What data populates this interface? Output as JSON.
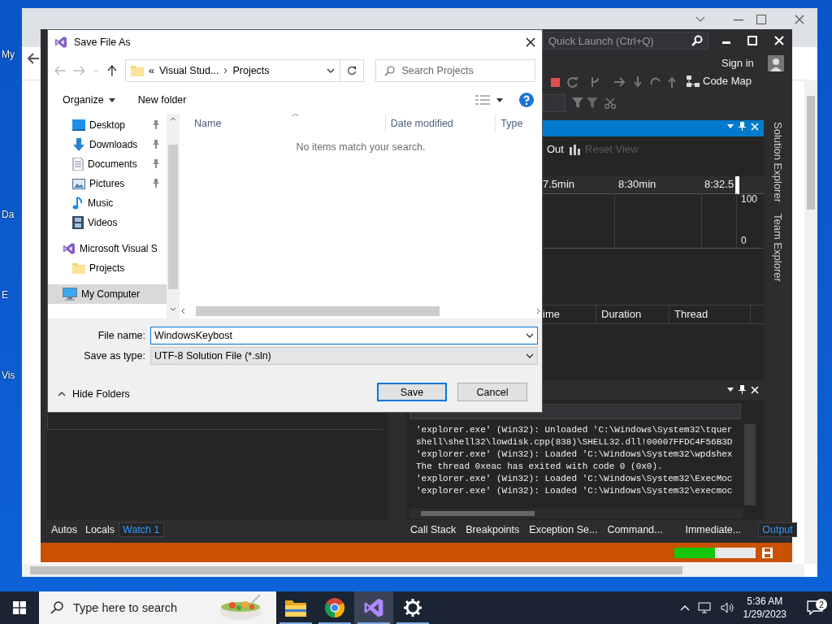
{
  "desktop": {
    "icon_labels": [
      "My",
      "Da",
      "E",
      "Vis"
    ]
  },
  "visual_studio": {
    "quick_launch": {
      "placeholder": "Quick Launch (Ctrl+Q)"
    },
    "sign_in": "Sign in",
    "code_map": "Code Map",
    "diagnostics": {
      "actions": [
        {
          "label": "Out",
          "disabled": false
        },
        {
          "label": "Reset View",
          "disabled": true
        }
      ],
      "time_ticks": [
        "7.5min",
        "8:30min",
        "8:32.5"
      ],
      "scale": [
        "100",
        "0"
      ],
      "columns": [
        "ime",
        "Duration",
        "Thread"
      ]
    },
    "side_tabs": [
      "Solution Explorer",
      "Team Explorer"
    ],
    "output_lines": [
      "'explorer.exe' (Win32): Unloaded 'C:\\Windows\\System32\\tquer",
      "shell\\shell32\\lowdisk.cpp(838)\\SHELL32.dll!00007FFDC4F56B3D",
      "'explorer.exe' (Win32): Loaded 'C:\\Windows\\System32\\wpdshex",
      "The thread 0xeac has exited with code 0 (0x0).",
      "'explorer.exe' (Win32): Loaded 'C:\\Windows\\System32\\ExecMoc",
      "'explorer.exe' (Win32): Loaded 'C:\\Windows\\System32\\execmoc"
    ],
    "left_tabs": [
      {
        "label": "Autos",
        "selected": false
      },
      {
        "label": "Locals",
        "selected": false
      },
      {
        "label": "Watch 1",
        "selected": true
      }
    ],
    "right_tabs": [
      {
        "label": "Call Stack",
        "selected": false
      },
      {
        "label": "Breakpoints",
        "selected": false
      },
      {
        "label": "Exception Se...",
        "selected": false
      },
      {
        "label": "Command...",
        "selected": false
      },
      {
        "label": "Immediate...",
        "selected": false
      },
      {
        "label": "Output",
        "selected": true
      }
    ],
    "status_bar": {
      "level": 0.5
    }
  },
  "dialog": {
    "title": "Save File As",
    "breadcrumb": [
      "«",
      "Visual Stud...",
      "Projects"
    ],
    "search": {
      "placeholder": "Search Projects"
    },
    "toolbar": [
      "Organize",
      "New folder"
    ],
    "nav": [
      {
        "label": "Desktop",
        "kind": "desktop",
        "pinned": true,
        "selected": false
      },
      {
        "label": "Downloads",
        "kind": "downloads",
        "pinned": true,
        "selected": false
      },
      {
        "label": "Documents",
        "kind": "documents",
        "pinned": true,
        "selected": false
      },
      {
        "label": "Pictures",
        "kind": "pictures",
        "pinned": true,
        "selected": false
      },
      {
        "label": "Music",
        "kind": "music",
        "pinned": false,
        "selected": false
      },
      {
        "label": "Videos",
        "kind": "videos",
        "pinned": false,
        "selected": false
      },
      {
        "label": "Microsoft Visual S",
        "kind": "vs",
        "pinned": false,
        "selected": false,
        "children": [
          {
            "label": "Projects",
            "kind": "folder",
            "pinned": false,
            "selected": false
          }
        ]
      },
      {
        "label": "My Computer",
        "kind": "computer",
        "pinned": false,
        "selected": true
      }
    ],
    "columns": [
      "Name",
      "Date modified",
      "Type"
    ],
    "empty_message": "No items match your search.",
    "file_name_label": "File name:",
    "file_name": "WindowsKeybost",
    "save_as_type_label": "Save as type:",
    "save_as_type": "UTF-8 Solution File (*.sln)",
    "hide_folders": "Hide Folders",
    "buttons": [
      "Save",
      "Cancel"
    ]
  },
  "taskbar": {
    "search": {
      "placeholder": "Type here to search"
    },
    "apps": [
      {
        "kind": "files",
        "active": false
      },
      {
        "kind": "chrome",
        "active": false
      },
      {
        "kind": "vs",
        "active": true
      },
      {
        "kind": "settings",
        "active": false
      }
    ],
    "time": "5:36 AM",
    "date": "1/29/2023",
    "notifications": "2"
  }
}
